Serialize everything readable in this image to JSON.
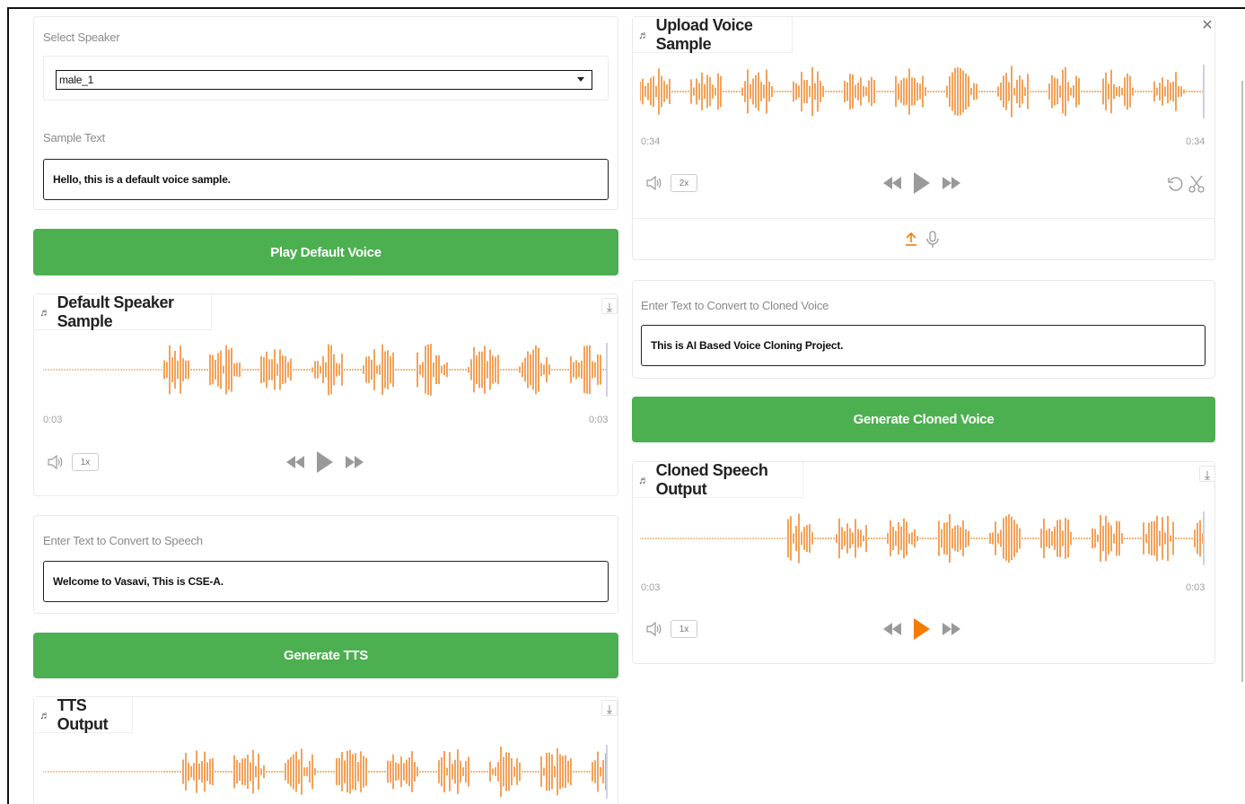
{
  "left": {
    "speaker": {
      "label": "Select Speaker",
      "value": "male_1"
    },
    "sample_text": {
      "label": "Sample Text",
      "value": "Hello, this is a default voice sample."
    },
    "play_default_button": "Play Default Voice",
    "default_sample": {
      "title": "Default Speaker Sample",
      "time_start": "0:03",
      "time_end": "0:03",
      "rate": "1x"
    },
    "tts_input": {
      "label": "Enter Text to Convert to Speech",
      "value": "Welcome to Vasavi, This is CSE-A."
    },
    "generate_tts_button": "Generate TTS",
    "tts_output": {
      "title": "TTS Output"
    }
  },
  "right": {
    "upload_sample": {
      "title": "Upload Voice Sample",
      "time_start": "0:34",
      "time_end": "0:34",
      "rate": "2x"
    },
    "clone_input": {
      "label": "Enter Text to Convert to Cloned Voice",
      "value": "This is AI Based Voice Cloning Project."
    },
    "generate_clone_button": "Generate Cloned Voice",
    "cloned_output": {
      "title": "Cloned Speech Output",
      "time_start": "0:03",
      "time_end": "0:03",
      "rate": "1x"
    }
  },
  "colors": {
    "accent_green": "#4caf50",
    "waveform_orange": "#f28b30",
    "play_active": "#f57c00"
  },
  "icons": [
    "music-note-icon",
    "download-icon",
    "volume-icon",
    "rewind-icon",
    "play-icon",
    "fast-forward-icon",
    "undo-icon",
    "scissors-icon",
    "upload-icon",
    "microphone-icon",
    "close-icon"
  ]
}
